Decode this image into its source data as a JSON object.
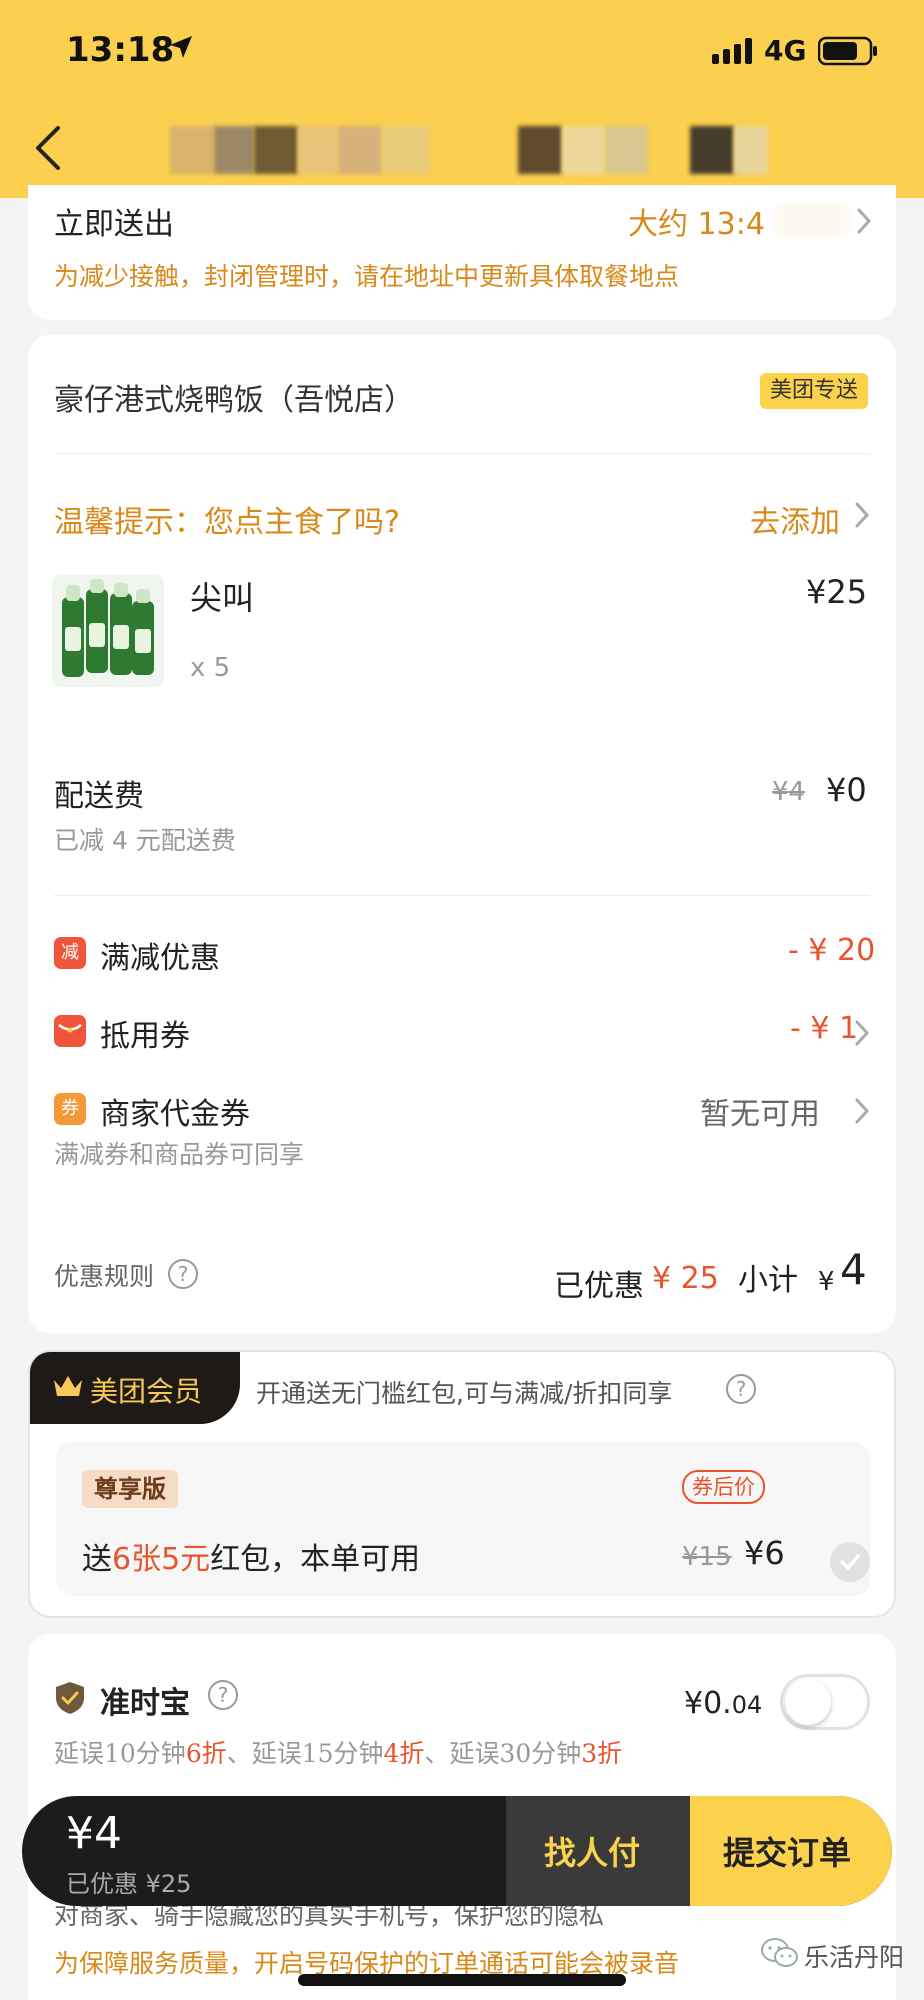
{
  "status_bar": {
    "time": "13:18",
    "network": "4G"
  },
  "header": {
    "title_blurred": true
  },
  "delivery": {
    "label": "立即送出",
    "eta": "大约 13:4",
    "note": "为减少接触，封闭管理时，请在地址中更新具体取餐地点"
  },
  "store": {
    "name": "豪仔港式烧鸭饭（吾悦店）",
    "tag": "美团专送"
  },
  "tip": {
    "text": "温馨提示：您点主食了吗?",
    "action": "去添加"
  },
  "item": {
    "name": "尖叫",
    "price": "¥25",
    "qty": "x 5"
  },
  "delivery_fee": {
    "label": "配送费",
    "original": "¥4",
    "price": "¥0",
    "note": "已减 4 元配送费"
  },
  "discounts": [
    {
      "icon": "减",
      "label": "满减优惠",
      "value": "- ¥ 20",
      "color": "#f0543a"
    },
    {
      "icon": "",
      "label": "抵用券",
      "value": "- ¥ 1",
      "color": "#f0543a"
    },
    {
      "icon": "券",
      "label": "商家代金券",
      "value": "暂无可用",
      "color": "#f39a36"
    }
  ],
  "merchant_voucher_note": "满减券和商品券可同享",
  "rules": {
    "label": "优惠规则"
  },
  "summary": {
    "saved_label": "已优惠",
    "saved_value": "¥ 25",
    "subtotal_label": "小计",
    "subtotal_currency": "¥",
    "subtotal_value": "4"
  },
  "vip": {
    "title": "美团会员",
    "desc": "开通送无门槛红包,可与满减/折扣同享",
    "tier": "尊享版",
    "offer_prefix": "送",
    "offer_highlight": "6张5元",
    "offer_suffix": "红包，本单可用",
    "after_label": "券后价",
    "original": "¥15",
    "price": "¥6"
  },
  "insurance": {
    "title": "准时宝",
    "price_main": "¥0.",
    "price_dec": "04",
    "desc_parts": [
      "延误10分钟",
      "6折",
      "、延误15分钟",
      "4折",
      "、延误30分钟",
      "3折"
    ],
    "enabled": false
  },
  "privacy": {
    "line1": "对商家、骑手隐藏您的真实手机号，保护您的隐私",
    "line2": "为保障服务质量，开启号码保护的订单通话可能会被录音"
  },
  "footer": {
    "total": "¥4",
    "saved": "已优惠 ¥25",
    "pay_for_me": "找人付",
    "submit": "提交订单"
  },
  "watermark": "乐活丹阳",
  "colors": {
    "brand_yellow": "#fbd04e",
    "accent_orange": "#d9891a",
    "price_red": "#e8552d"
  }
}
